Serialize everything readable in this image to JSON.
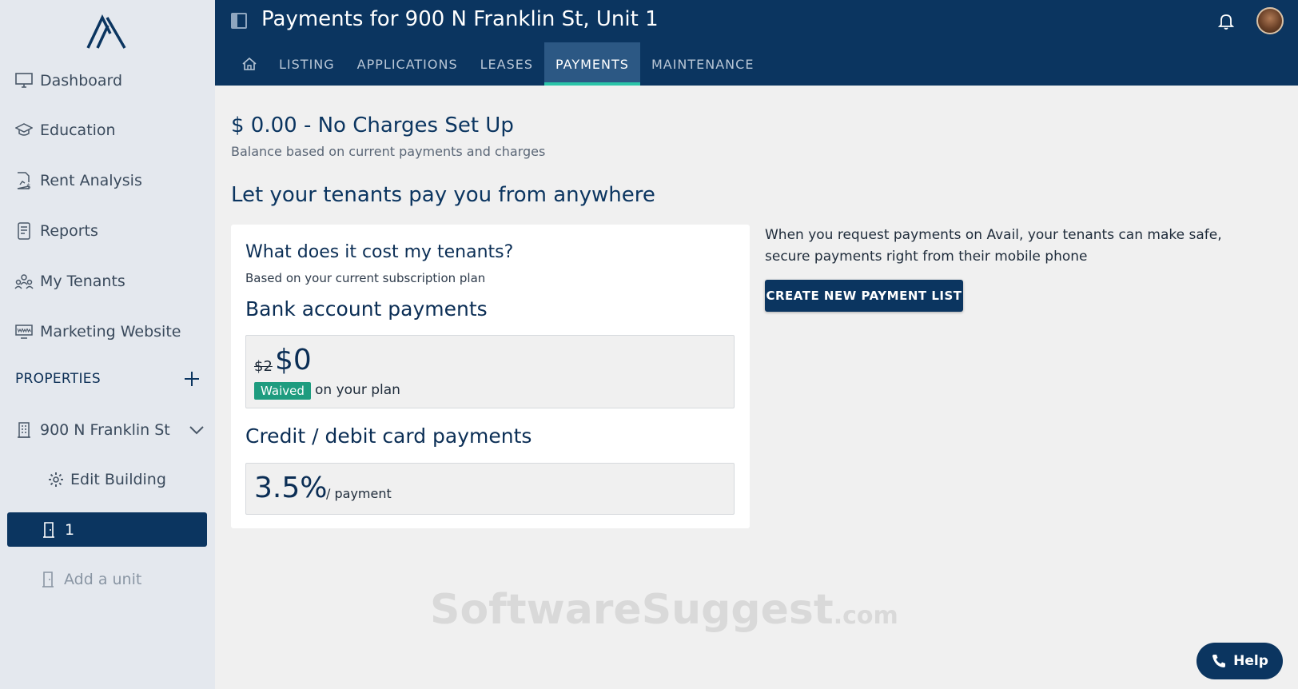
{
  "header": {
    "title": "Payments for 900 N Franklin St, Unit 1",
    "tabs": [
      {
        "label": "LISTING"
      },
      {
        "label": "APPLICATIONS"
      },
      {
        "label": "LEASES"
      },
      {
        "label": "PAYMENTS",
        "active": true
      },
      {
        "label": "MAINTENANCE"
      }
    ]
  },
  "sidebar": {
    "items": [
      {
        "label": "Dashboard",
        "icon": "monitor-icon"
      },
      {
        "label": "Education",
        "icon": "graduation-cap-icon"
      },
      {
        "label": "Rent Analysis",
        "icon": "chart-document-icon"
      },
      {
        "label": "Reports",
        "icon": "report-icon"
      },
      {
        "label": "My Tenants",
        "icon": "people-icon"
      },
      {
        "label": "Marketing Website",
        "icon": "www-icon"
      }
    ],
    "properties_label": "PROPERTIES",
    "building": "900 N Franklin St",
    "edit_building": "Edit Building",
    "active_unit": "1",
    "add_unit": "Add a unit"
  },
  "main": {
    "balance": "$ 0.00 - No Charges Set Up",
    "balance_sub": "Balance based on current payments and charges",
    "section_title": "Let your tenants pay you from anywhere",
    "card": {
      "title": "What does it cost my tenants?",
      "subtitle": "Based on your current subscription plan",
      "bank_title": "Bank account payments",
      "bank_old_price": "$2",
      "bank_new_price": "$0",
      "waived_badge": "Waived",
      "on_plan": "on your plan",
      "card_title": "Credit / debit card payments",
      "card_rate": "3.5%",
      "card_per": "/ payment"
    },
    "info_text": "When you request payments on Avail, your tenants can make safe, secure payments right from their mobile phone",
    "create_button": "CREATE NEW PAYMENT LIST"
  },
  "watermark": {
    "main": "SoftwareSuggest",
    "suffix": ".com"
  },
  "help_button": "Help",
  "colors": {
    "navy": "#0b3560",
    "accent_teal": "#2bc4a8",
    "badge_green": "#1e9c7f"
  }
}
